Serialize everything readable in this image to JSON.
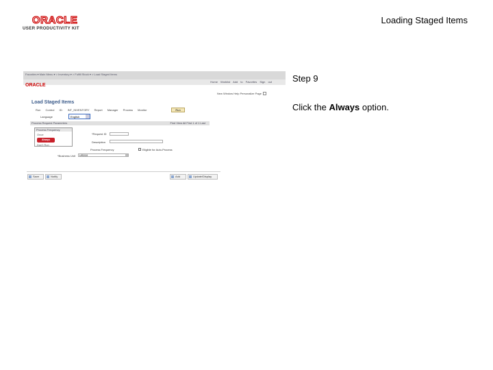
{
  "header": {
    "logo_brand": "ORACLE",
    "logo_tagline": "USER PRODUCTIVITY KIT",
    "title": "Loading Staged Items"
  },
  "instructions": {
    "step": "Step 9",
    "text_before": "Click the ",
    "text_bold": "Always",
    "text_after": " option."
  },
  "screenshot": {
    "breadcrumbs": "Favorites ▾   Main Menu ▾   > Inventory ▾  > Fulfill Stock ▾  > Load Staged Items",
    "nav_links": "Home  Worklist  Add to Favorites  Sign out",
    "logo": "ORACLE",
    "toolbar": "New Window  Help  Personalize Page",
    "page_title": "Load Staged Items",
    "row1": "Run Control ID:  INT_INVENTORY    Report Manager    Process Monitor",
    "run_button": "Run",
    "language_label": "Language",
    "language_value": "English",
    "section_title": "Process Request Parameters",
    "section_right": "Find  View All  First  1 of 1  Last",
    "dropdown_header": "Process Frequency",
    "dropdown_options": [
      "Once",
      "Always",
      "Don't Run"
    ],
    "request_id_label": "*Request ID",
    "description_label": "Description",
    "frequency_label": "Process Frequency",
    "checkbox_label": "Eligible for Auto-Process",
    "business_unit_label": "*Business Unit",
    "business_unit_value": "US010",
    "btn_save": "Save",
    "btn_notify": "Notify",
    "btn_add": "Add",
    "btn_update": "Update/Display"
  }
}
